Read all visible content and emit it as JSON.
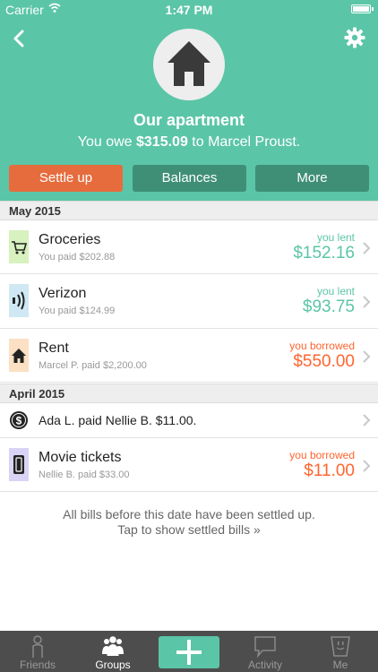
{
  "status_bar": {
    "carrier": "Carrier",
    "time": "1:47 PM"
  },
  "header": {
    "group_name": "Our apartment",
    "owe_prefix": "You owe",
    "owe_amount": "$315.09",
    "owe_suffix": "to Marcel Proust.",
    "buttons": {
      "settle_up": "Settle up",
      "balances": "Balances",
      "more": "More"
    },
    "colors": {
      "header_bg": "#5bc5a7",
      "settle_bg": "#e66c3e",
      "secondary_bg": "#3f8f76"
    }
  },
  "sections": [
    {
      "title": "May 2015",
      "items": [
        {
          "icon": "cart-icon",
          "title": "Groceries",
          "subtitle": "You paid $202.88",
          "label": "you lent",
          "amount": "$152.16",
          "kind": "lent"
        },
        {
          "icon": "signal-icon",
          "title": "Verizon",
          "subtitle": "You paid $124.99",
          "label": "you lent",
          "amount": "$93.75",
          "kind": "lent"
        },
        {
          "icon": "house-icon",
          "title": "Rent",
          "subtitle": "Marcel P. paid $2,200.00",
          "label": "you borrowed",
          "amount": "$550.00",
          "kind": "borrowed"
        }
      ]
    },
    {
      "title": "April 2015",
      "items": [
        {
          "icon": "dollar-icon",
          "title": "Ada L. paid Nellie B. $11.00.",
          "kind": "payment"
        },
        {
          "icon": "ticket-icon",
          "title": "Movie tickets",
          "subtitle": "Nellie B. paid $33.00",
          "label": "you borrowed",
          "amount": "$11.00",
          "kind": "borrowed"
        }
      ]
    }
  ],
  "settled_note": {
    "line1": "All bills before this date have been settled up.",
    "line2": "Tap to show settled bills »"
  },
  "tabbar": {
    "friends": "Friends",
    "groups": "Groups",
    "activity": "Activity",
    "me": "Me",
    "active": "Groups"
  },
  "colors": {
    "lent": "#5bc5a7",
    "borrowed": "#ff652f",
    "tabbar_bg": "#4d4d4d"
  }
}
